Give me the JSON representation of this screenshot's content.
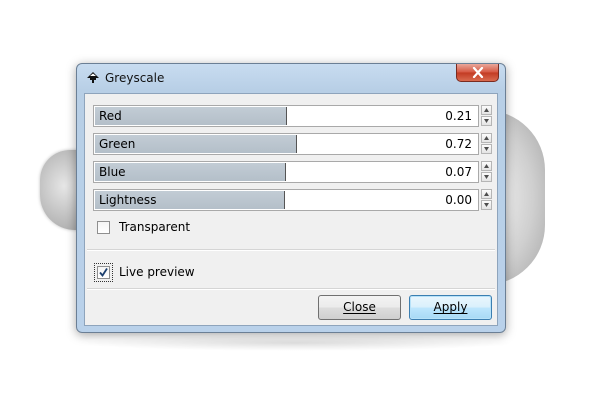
{
  "window": {
    "title": "Greyscale"
  },
  "sliders": [
    {
      "label": "Red",
      "value": "0.21",
      "fill_fraction": 0.5
    },
    {
      "label": "Green",
      "value": "0.72",
      "fill_fraction": 0.526
    },
    {
      "label": "Blue",
      "value": "0.07",
      "fill_fraction": 0.497
    },
    {
      "label": "Lightness",
      "value": "0.00",
      "fill_fraction": 0.495
    }
  ],
  "options": {
    "transparent_label": "Transparent",
    "transparent_checked": false,
    "live_preview_label": "Live preview",
    "live_preview_checked": true
  },
  "buttons": {
    "close_label": "Close",
    "apply_label": "Apply"
  },
  "colors": {
    "slider_fill": "#b8c3cd",
    "title_bar": "#c4d8ee",
    "close_button": "#c94a33",
    "default_button": "#bee6fd"
  },
  "icons": {
    "app_icon": "inkscape-icon",
    "close": "close-icon",
    "spin_up": "spin-up-icon",
    "spin_down": "spin-down-icon",
    "check": "checkmark-icon"
  }
}
